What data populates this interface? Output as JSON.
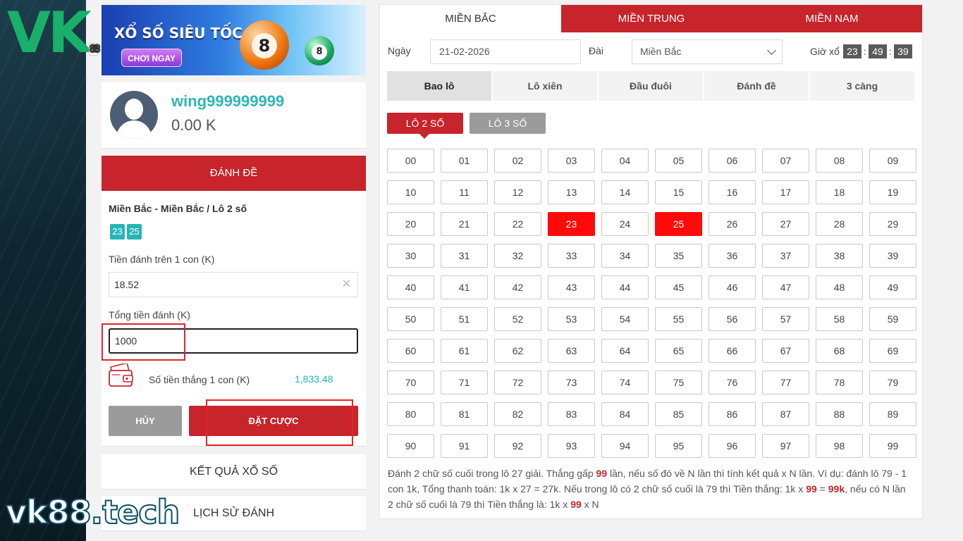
{
  "brand": {
    "logo_top_letters": "VK",
    "logo_top_digits": "88",
    "logo_bottom": "vk88.tech"
  },
  "banner": {
    "title": "XỔ SỐ SIÊU TỐC",
    "button": "CHƠI NGAY",
    "ball1": "8",
    "ball2": "8"
  },
  "user": {
    "name": "wing999999999",
    "balance": "0.00 K"
  },
  "bet_panel": {
    "header": "ĐÁNH ĐỀ",
    "selection_title": "Miền Bắc - Miền Bắc / Lô 2 số",
    "chips": [
      "23",
      "25"
    ],
    "stake_label": "Tiền đánh trên 1 con (K)",
    "stake_value": "18.52",
    "total_label": "Tổng tiền đánh (K)",
    "total_value": "1000",
    "win_label": "Số tiền thắng 1 con (K)",
    "win_value": "1,833.48",
    "cancel": "HỦY",
    "place": "ĐẶT CƯỢC"
  },
  "links": {
    "results": "KẾT QUẢ XỔ SỐ",
    "history": "LỊCH SỬ ĐÁNH"
  },
  "region_tabs": [
    "MIỀN BẮC",
    "MIỀN TRUNG",
    "MIỀN NAM"
  ],
  "filters": {
    "date_label": "Ngày",
    "date_value": "21-02-2026",
    "station_label": "Đài",
    "station_value": "Miền Bắc",
    "draw_time_label": "Giờ xổ",
    "hh": "23",
    "mm": "49",
    "ss": "39",
    "sep": ":"
  },
  "bet_types": [
    "Bao lô",
    "Lô xiên",
    "Đầu đuôi",
    "Đánh đề",
    "3 càng"
  ],
  "sub_types": [
    "LÔ 2 SỐ",
    "LÔ 3 SỐ"
  ],
  "numbers": [
    "00",
    "01",
    "02",
    "03",
    "04",
    "05",
    "06",
    "07",
    "08",
    "09",
    "10",
    "11",
    "12",
    "13",
    "14",
    "15",
    "16",
    "17",
    "18",
    "19",
    "20",
    "21",
    "22",
    "23",
    "24",
    "25",
    "26",
    "27",
    "28",
    "29",
    "30",
    "31",
    "32",
    "33",
    "34",
    "35",
    "36",
    "37",
    "38",
    "39",
    "40",
    "41",
    "42",
    "43",
    "44",
    "45",
    "46",
    "47",
    "48",
    "49",
    "50",
    "51",
    "52",
    "53",
    "54",
    "55",
    "56",
    "57",
    "58",
    "59",
    "60",
    "61",
    "62",
    "63",
    "64",
    "65",
    "66",
    "67",
    "68",
    "69",
    "70",
    "71",
    "72",
    "73",
    "74",
    "75",
    "76",
    "77",
    "78",
    "79",
    "80",
    "81",
    "82",
    "83",
    "84",
    "85",
    "86",
    "87",
    "88",
    "89",
    "90",
    "91",
    "92",
    "93",
    "94",
    "95",
    "96",
    "97",
    "98",
    "99"
  ],
  "selected_numbers": [
    "23",
    "25"
  ],
  "description": {
    "p1": "Đánh 2 chữ số cuối trong lô 27 giải. Thắng gấp ",
    "b1": "99",
    "p2": " lần, nếu số đó về N lần thì tính kết quả x N lần. Ví dụ: đánh lô 79 - 1 con 1k, Tổng thanh toán: 1k x 27 = 27k. Nếu trong lô có 2 chữ số cuối là 79 thì Tiền thắng: 1k x ",
    "b2": "99",
    "p3": " = ",
    "b3": "99k",
    "p4": ", nếu có N lần 2 chữ số cuối là 79 thì Tiền thắng là: 1k x ",
    "b4": "99",
    "p5": " x N"
  },
  "colors": {
    "primary_red": "#c8242b",
    "selected_red": "#ff0a0a",
    "teal": "#26b5b5",
    "grey_button": "#9b9b9b"
  }
}
